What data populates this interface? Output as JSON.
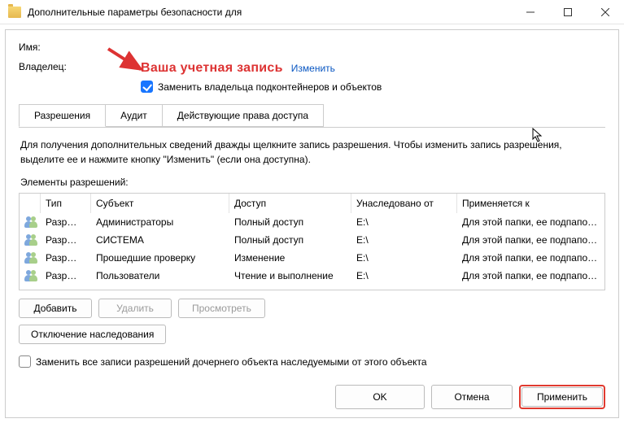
{
  "window": {
    "title": "Дополнительные параметры безопасности для"
  },
  "labels": {
    "name": "Имя:",
    "owner": "Владелец:",
    "annotation": "Ваша учетная запись",
    "change_link": "Изменить",
    "replace_owner": "Заменить владельца подконтейнеров и объектов",
    "description": "Для получения дополнительных сведений дважды щелкните запись разрешения. Чтобы изменить запись разрешения, выделите ее и нажмите кнопку \"Изменить\" (если она доступна).",
    "elements_heading": "Элементы разрешений:",
    "replace_all": "Заменить все записи разрешений дочернего объекта наследуемыми от этого объекта"
  },
  "tabs": [
    {
      "label": "Разрешения"
    },
    {
      "label": "Аудит"
    },
    {
      "label": "Действующие права доступа"
    }
  ],
  "table": {
    "headers": {
      "type": "Тип",
      "subject": "Субъект",
      "access": "Доступ",
      "inherited": "Унаследовано от",
      "applies": "Применяется к"
    },
    "rows": [
      {
        "type": "Разр…",
        "subject": "Администраторы",
        "access": "Полный доступ",
        "inherited": "E:\\",
        "applies": "Для этой папки, ее подпапок …"
      },
      {
        "type": "Разр…",
        "subject": "СИСТЕМА",
        "access": "Полный доступ",
        "inherited": "E:\\",
        "applies": "Для этой папки, ее подпапок …"
      },
      {
        "type": "Разр…",
        "subject": "Прошедшие проверку",
        "access": "Изменение",
        "inherited": "E:\\",
        "applies": "Для этой папки, ее подпапок …"
      },
      {
        "type": "Разр…",
        "subject": "Пользователи",
        "access": "Чтение и выполнение",
        "inherited": "E:\\",
        "applies": "Для этой папки, ее подпапок …"
      }
    ]
  },
  "buttons": {
    "add": "Добавить",
    "delete": "Удалить",
    "view": "Просмотреть",
    "disable_inherit": "Отключение наследования",
    "ok": "OK",
    "cancel": "Отмена",
    "apply": "Применить"
  }
}
